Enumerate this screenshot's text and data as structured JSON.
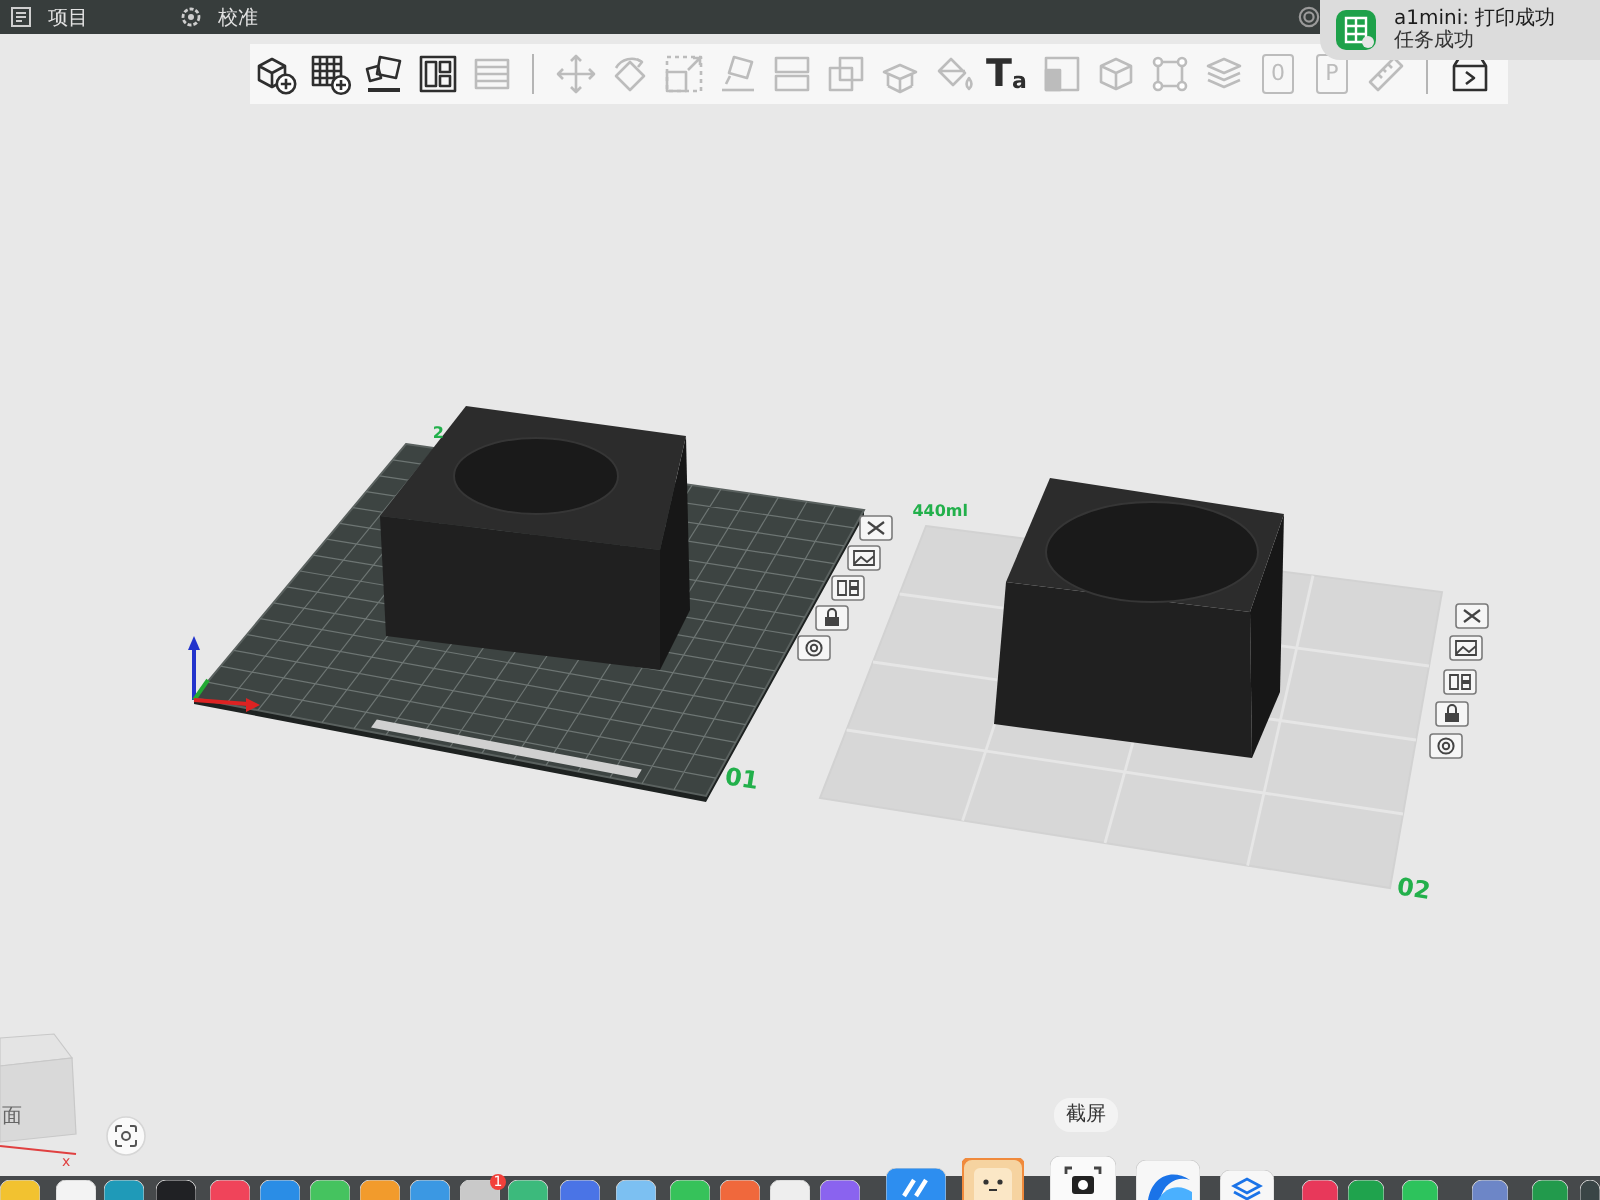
{
  "topbar": {
    "menus": [
      {
        "label": "项目"
      },
      {
        "label": "校准"
      }
    ]
  },
  "toolbar": {
    "groups": [
      [
        {
          "kind": "icon",
          "disabled": false
        },
        {
          "kind": "icon",
          "disabled": false
        },
        {
          "kind": "icon",
          "disabled": false
        },
        {
          "kind": "icon",
          "disabled": false
        },
        {
          "kind": "icon",
          "disabled": true
        }
      ],
      [
        {
          "kind": "icon",
          "disabled": true
        },
        {
          "kind": "icon",
          "disabled": true
        },
        {
          "kind": "icon",
          "disabled": true
        },
        {
          "kind": "icon",
          "disabled": true
        },
        {
          "kind": "icon",
          "disabled": true
        },
        {
          "kind": "icon",
          "disabled": true
        },
        {
          "kind": "icon",
          "disabled": true
        },
        {
          "kind": "icon",
          "disabled": true
        },
        {
          "kind": "glyph",
          "glyph": "T$_{a}$",
          "disabled": false
        },
        {
          "kind": "icon",
          "disabled": true
        },
        {
          "kind": "icon",
          "disabled": true
        },
        {
          "kind": "icon",
          "disabled": true
        },
        {
          "kind": "icon",
          "disabled": true
        },
        {
          "kind": "page",
          "glyph": "0",
          "disabled": true
        },
        {
          "kind": "page",
          "glyph": "P",
          "disabled": true
        },
        {
          "kind": "icon",
          "disabled": true
        }
      ],
      [
        {
          "kind": "icon",
          "disabled": false
        }
      ]
    ]
  },
  "notification": {
    "title": "a1mini: 打印成功",
    "message": "任务成功"
  },
  "plates": [
    {
      "name": "2",
      "number": "01",
      "selected": true
    },
    {
      "name": "440ml",
      "number": "02",
      "selected": false
    }
  ],
  "view_cube": {
    "face_label": "面",
    "axis_label": "x"
  },
  "dock": {
    "badge": "1",
    "tooltip": "截屏"
  }
}
